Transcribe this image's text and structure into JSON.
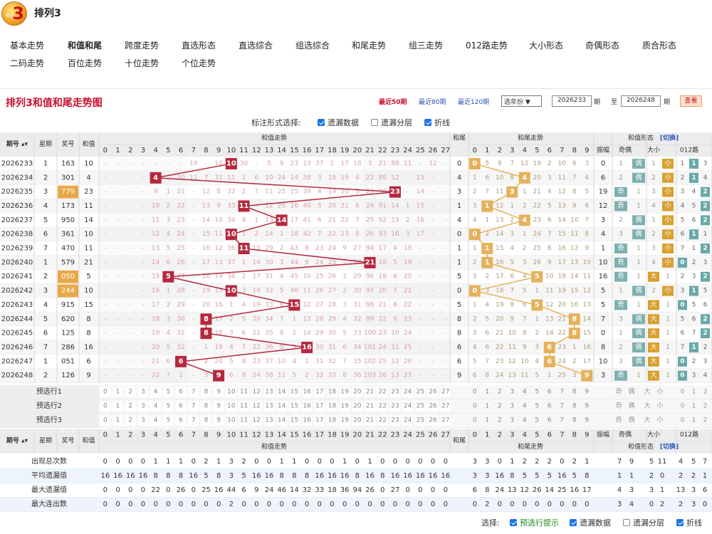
{
  "brand": {
    "title": "排列3",
    "logo_digit": "3",
    "logo_text": "排列"
  },
  "nav": [
    "基本走势",
    "和值和尾",
    "跨度走势",
    "直选形态",
    "直选综合",
    "组选综合",
    "和尾走势",
    "组三走势",
    "012路走势",
    "大小形态",
    "奇偶形态",
    "质合形态",
    "二码走势",
    "百位走势",
    "十位走势",
    "个位走势"
  ],
  "nav_active": 1,
  "chart_title": "排列3和值和尾走势图",
  "ranges": [
    "最近50期",
    "最近80期",
    "最近120期"
  ],
  "year_select": "选年份 ▼",
  "from_period": "2026233",
  "to_period": "2026248",
  "period_unit": "期",
  "to_label": "至",
  "query_label": "查看",
  "top_options": {
    "label": "标注形式选择:",
    "items": [
      {
        "text": "遗漏数据",
        "checked": true
      },
      {
        "text": "遗漏分层",
        "checked": false
      },
      {
        "text": "折线",
        "checked": true
      }
    ]
  },
  "headers": {
    "period": "期号",
    "week": "星期",
    "award": "奖号",
    "sum": "和值",
    "sum_trend": "和值走势",
    "tail": "和尾",
    "tail_trend": "和尾走势",
    "form": "和值形态",
    "switch": "[切换]",
    "amp": "振幅",
    "oe": "奇偶",
    "bs": "大小",
    "r012": "012路"
  },
  "form_labels": {
    "odd": "奇",
    "even": "偶",
    "big": "大",
    "small": "小"
  },
  "rows": [
    {
      "p": "2026233",
      "w": "1",
      "a": "163",
      "s": 10,
      "hl": false,
      "amp": "0",
      "mm": [
        0,
        0,
        0,
        0,
        0,
        0,
        0,
        19,
        0,
        10,
        6,
        30,
        0,
        5,
        9,
        23,
        13,
        37,
        2,
        17,
        18,
        3,
        21,
        88,
        11,
        0,
        12,
        0
      ],
      "tm": [
        0,
        5,
        9,
        7,
        12,
        19,
        2,
        10,
        6,
        3
      ]
    },
    {
      "p": "2026234",
      "w": "2",
      "a": "301",
      "s": 4,
      "hl": false,
      "amp": "6",
      "mm": [
        0,
        0,
        0,
        0,
        8,
        0,
        20,
        11,
        7,
        31,
        11,
        1,
        6,
        10,
        24,
        14,
        38,
        3,
        18,
        19,
        4,
        22,
        89,
        12,
        0,
        13,
        0,
        0
      ],
      "tm": [
        1,
        6,
        10,
        8,
        0,
        20,
        3,
        11,
        7,
        4
      ]
    },
    {
      "p": "2026235",
      "w": "3",
      "a": "779",
      "s": 23,
      "hl": true,
      "amp": "19",
      "mm": [
        0,
        0,
        0,
        0,
        9,
        1,
        21,
        0,
        12,
        8,
        32,
        2,
        7,
        11,
        25,
        15,
        39,
        4,
        19,
        20,
        5,
        23,
        90,
        13,
        0,
        14,
        0,
        0
      ],
      "tm": [
        2,
        7,
        11,
        0,
        1,
        21,
        4,
        12,
        8,
        5
      ]
    },
    {
      "p": "2026236",
      "w": "4",
      "a": "173",
      "s": 11,
      "hl": false,
      "amp": "12",
      "mm": [
        0,
        0,
        0,
        0,
        10,
        2,
        22,
        0,
        13,
        9,
        33,
        3,
        0,
        12,
        26,
        16,
        40,
        5,
        20,
        21,
        6,
        24,
        91,
        14,
        1,
        15,
        0,
        0
      ],
      "tm": [
        3,
        0,
        12,
        1,
        2,
        22,
        5,
        13,
        9,
        6
      ]
    },
    {
      "p": "2026237",
      "w": "5",
      "a": "950",
      "s": 14,
      "hl": false,
      "amp": "3",
      "mm": [
        0,
        0,
        0,
        0,
        11,
        3,
        23,
        0,
        14,
        10,
        34,
        4,
        1,
        13,
        0,
        17,
        41,
        6,
        21,
        22,
        7,
        25,
        92,
        15,
        2,
        16,
        0,
        0
      ],
      "tm": [
        4,
        1,
        13,
        2,
        0,
        23,
        6,
        14,
        10,
        7
      ]
    },
    {
      "p": "2026238",
      "w": "6",
      "a": "361",
      "s": 10,
      "hl": false,
      "amp": "4",
      "mm": [
        0,
        0,
        0,
        0,
        12,
        4,
        24,
        0,
        15,
        11,
        0,
        5,
        2,
        14,
        1,
        18,
        42,
        7,
        22,
        23,
        8,
        26,
        93,
        16,
        3,
        17,
        0,
        0
      ],
      "tm": [
        0,
        2,
        14,
        3,
        1,
        24,
        7,
        15,
        11,
        8
      ]
    },
    {
      "p": "2026239",
      "w": "7",
      "a": "470",
      "s": 11,
      "hl": false,
      "amp": "1",
      "mm": [
        0,
        0,
        0,
        0,
        13,
        5,
        25,
        0,
        16,
        12,
        36,
        0,
        15,
        29,
        2,
        43,
        8,
        23,
        24,
        9,
        27,
        94,
        17,
        4,
        18,
        0,
        0,
        0
      ],
      "tm": [
        1,
        0,
        15,
        4,
        2,
        25,
        8,
        16,
        12,
        9
      ]
    },
    {
      "p": "2026240",
      "w": "1",
      "a": "579",
      "s": 21,
      "hl": false,
      "amp": "10",
      "mm": [
        0,
        0,
        0,
        0,
        14,
        6,
        26,
        0,
        17,
        13,
        37,
        1,
        16,
        30,
        3,
        44,
        9,
        24,
        25,
        0,
        28,
        95,
        18,
        5,
        19,
        0,
        0,
        0
      ],
      "tm": [
        2,
        1,
        16,
        5,
        3,
        26,
        9,
        17,
        13,
        10
      ]
    },
    {
      "p": "2026241",
      "w": "2",
      "a": "050",
      "s": 5,
      "hl": true,
      "amp": "16",
      "mm": [
        0,
        0,
        0,
        0,
        15,
        0,
        27,
        0,
        18,
        14,
        38,
        2,
        17,
        31,
        4,
        45,
        10,
        25,
        26,
        1,
        29,
        96,
        19,
        6,
        20,
        0,
        0,
        0
      ],
      "tm": [
        3,
        2,
        17,
        6,
        4,
        0,
        10,
        18,
        14,
        11
      ]
    },
    {
      "p": "2026242",
      "w": "3",
      "a": "244",
      "s": 10,
      "hl": true,
      "amp": "5",
      "mm": [
        0,
        0,
        0,
        0,
        16,
        1,
        28,
        0,
        19,
        15,
        0,
        3,
        18,
        32,
        5,
        46,
        11,
        26,
        27,
        2,
        30,
        97,
        20,
        7,
        21,
        0,
        0,
        0
      ],
      "tm": [
        0,
        3,
        18,
        7,
        5,
        1,
        11,
        19,
        15,
        12
      ]
    },
    {
      "p": "2026243",
      "w": "4",
      "a": "915",
      "s": 15,
      "hl": false,
      "amp": "5",
      "mm": [
        0,
        0,
        0,
        0,
        17,
        2,
        29,
        0,
        20,
        16,
        1,
        4,
        19,
        33,
        6,
        0,
        12,
        27,
        28,
        3,
        31,
        98,
        21,
        8,
        22,
        0,
        0,
        0
      ],
      "tm": [
        1,
        4,
        19,
        8,
        6,
        0,
        12,
        20,
        16,
        13
      ]
    },
    {
      "p": "2026244",
      "w": "5",
      "a": "620",
      "s": 8,
      "hl": false,
      "amp": "7",
      "mm": [
        0,
        0,
        0,
        0,
        18,
        3,
        30,
        0,
        0,
        17,
        2,
        5,
        20,
        34,
        7,
        1,
        13,
        28,
        29,
        4,
        32,
        99,
        22,
        9,
        23,
        0,
        0,
        0
      ],
      "tm": [
        2,
        5,
        20,
        9,
        7,
        1,
        13,
        21,
        0,
        14
      ]
    },
    {
      "p": "2026245",
      "w": "6",
      "a": "125",
      "s": 8,
      "hl": false,
      "amp": "0",
      "mm": [
        0,
        0,
        0,
        0,
        19,
        4,
        31,
        0,
        0,
        18,
        3,
        6,
        21,
        35,
        8,
        2,
        14,
        29,
        30,
        5,
        33,
        100,
        23,
        10,
        24,
        0,
        0,
        0
      ],
      "tm": [
        3,
        6,
        21,
        10,
        8,
        2,
        14,
        22,
        0,
        15
      ]
    },
    {
      "p": "2026246",
      "w": "7",
      "a": "286",
      "s": 16,
      "hl": false,
      "amp": "8",
      "mm": [
        0,
        0,
        0,
        0,
        20,
        5,
        32,
        0,
        1,
        19,
        4,
        7,
        22,
        36,
        9,
        3,
        0,
        30,
        31,
        6,
        34,
        101,
        24,
        11,
        25,
        0,
        0,
        0
      ],
      "tm": [
        4,
        6,
        22,
        11,
        9,
        3,
        0,
        23,
        1,
        16
      ]
    },
    {
      "p": "2026247",
      "w": "1",
      "a": "051",
      "s": 6,
      "hl": false,
      "amp": "10",
      "mm": [
        0,
        0,
        0,
        0,
        21,
        6,
        0,
        0,
        2,
        20,
        5,
        8,
        23,
        37,
        10,
        4,
        1,
        31,
        32,
        7,
        35,
        102,
        25,
        12,
        26,
        0,
        0,
        0
      ],
      "tm": [
        5,
        7,
        23,
        12,
        10,
        4,
        0,
        24,
        2,
        17
      ]
    },
    {
      "p": "2026248",
      "w": "2",
      "a": "126",
      "s": 9,
      "hl": false,
      "amp": "3",
      "mm": [
        0,
        0,
        0,
        0,
        22,
        7,
        1,
        0,
        3,
        0,
        6,
        9,
        24,
        38,
        11,
        5,
        2,
        32,
        33,
        8,
        36,
        103,
        26,
        13,
        27,
        0,
        0,
        0
      ],
      "tm": [
        6,
        8,
        24,
        13,
        11,
        5,
        1,
        25,
        3,
        0
      ]
    }
  ],
  "pre_rows": [
    "预选行1",
    "预选行2",
    "预选行3"
  ],
  "stats": [
    {
      "label": "出现总次数",
      "sum": [
        0,
        0,
        0,
        0,
        1,
        1,
        1,
        0,
        2,
        1,
        3,
        2,
        0,
        0,
        1,
        1,
        0,
        0,
        0,
        1,
        0,
        1,
        0,
        0,
        0,
        0,
        0,
        0
      ],
      "tail": [
        3,
        3,
        0,
        1,
        2,
        2,
        2,
        0,
        2,
        1
      ],
      "form": [
        7,
        9,
        5,
        11,
        4,
        5,
        7
      ]
    },
    {
      "label": "平均遗漏值",
      "sum": [
        16,
        16,
        16,
        16,
        8,
        8,
        8,
        16,
        5,
        8,
        3,
        5,
        16,
        16,
        8,
        8,
        8,
        16,
        16,
        16,
        8,
        16,
        8,
        16,
        16,
        16,
        16,
        16
      ],
      "tail": [
        3,
        3,
        16,
        8,
        5,
        5,
        5,
        16,
        5,
        8
      ],
      "form": [
        1,
        1,
        2,
        0,
        2,
        2,
        1
      ]
    },
    {
      "label": "最大遗漏值",
      "sum": [
        0,
        0,
        0,
        0,
        22,
        0,
        26,
        0,
        25,
        16,
        44,
        6,
        9,
        24,
        46,
        14,
        32,
        33,
        18,
        36,
        94,
        26,
        0,
        27,
        0,
        0,
        0,
        0
      ],
      "tail": [
        6,
        8,
        24,
        13,
        12,
        26,
        14,
        25,
        16,
        17
      ],
      "form": [
        4,
        3,
        3,
        1,
        13,
        3,
        6
      ]
    },
    {
      "label": "最大连出数",
      "sum": [
        0,
        0,
        0,
        0,
        0,
        0,
        0,
        0,
        0,
        0,
        2,
        0,
        0,
        0,
        0,
        0,
        0,
        0,
        0,
        0,
        0,
        0,
        0,
        0,
        0,
        0,
        0,
        0
      ],
      "tail": [
        0,
        2,
        0,
        0,
        0,
        0,
        0,
        0,
        0,
        0
      ],
      "form": [
        3,
        4,
        0,
        2,
        2,
        3,
        0
      ]
    }
  ],
  "bottom_options": {
    "label": "选择:",
    "items": [
      {
        "text": "预选行提示",
        "checked": true,
        "green": true
      },
      {
        "text": "遗漏数据",
        "checked": true
      },
      {
        "text": "遗漏分层",
        "checked": false
      },
      {
        "text": "折线",
        "checked": true
      }
    ]
  },
  "colors": {
    "red": "#c8102e",
    "sum_ball": "#b5283d",
    "tail_ball": "#e5b15a",
    "award_hl": "#e8a848",
    "blue_link": "#2a55b8",
    "odd_box": "#7fb0b0",
    "big_box": "#d9a030",
    "r012_box": "#6aa8a8"
  }
}
